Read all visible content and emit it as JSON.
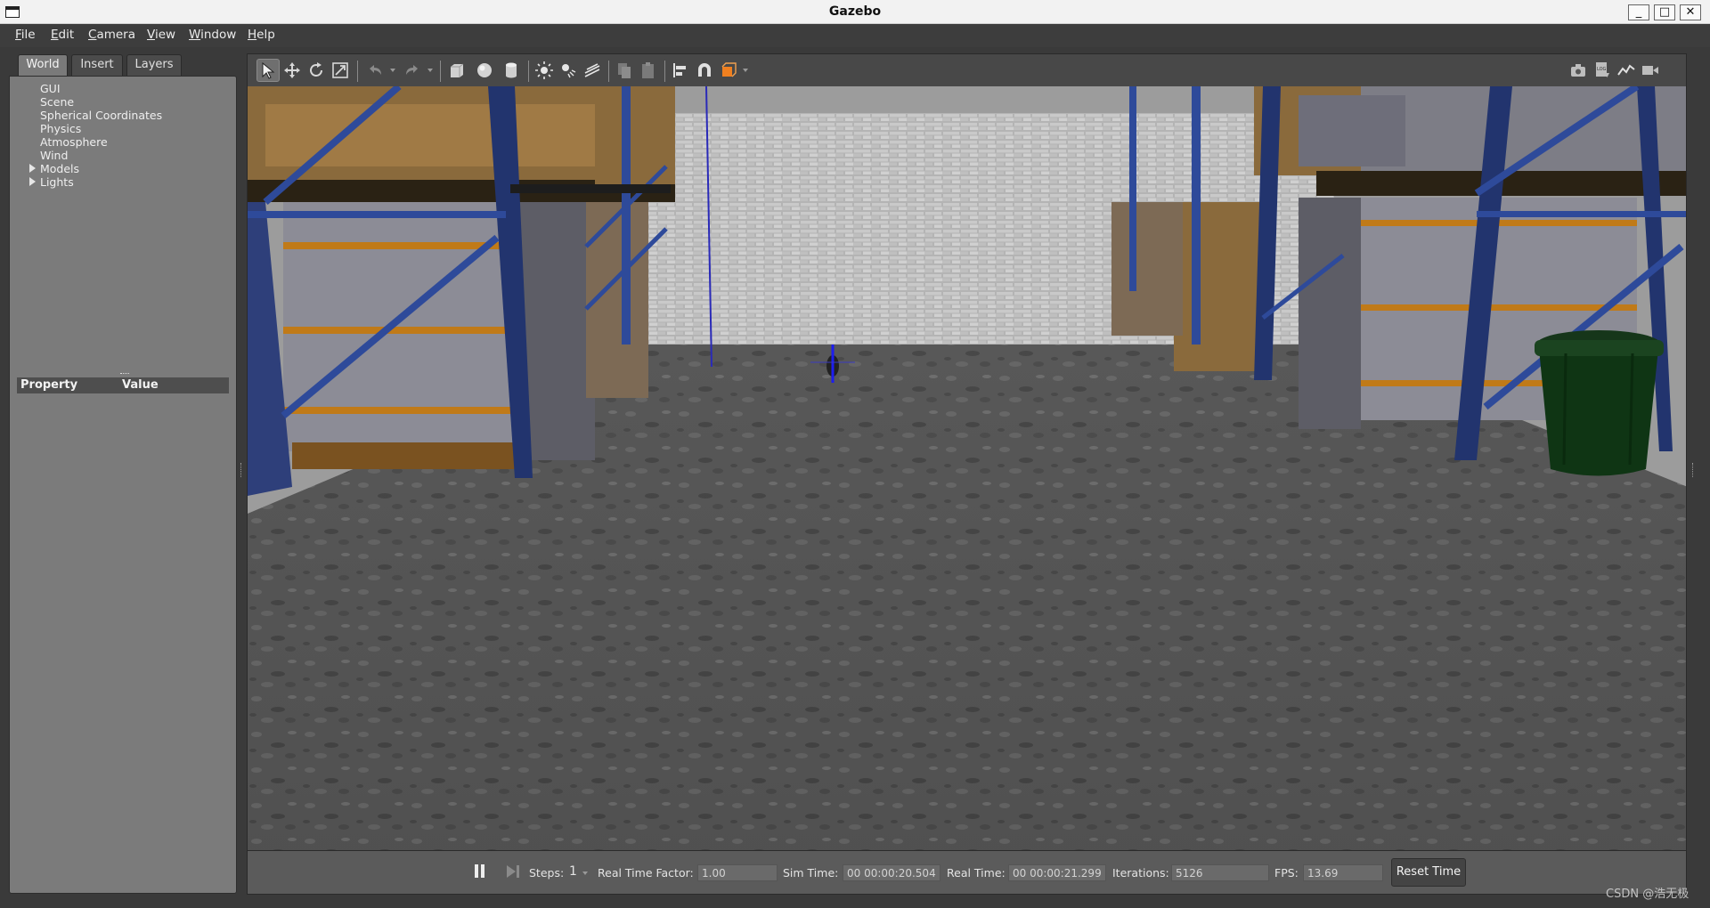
{
  "window": {
    "title": "Gazebo",
    "minimize": "_",
    "maximize": "□",
    "close": "✕"
  },
  "menu": [
    {
      "key": "F",
      "rest": "ile"
    },
    {
      "key": "E",
      "rest": "dit"
    },
    {
      "key": "C",
      "rest": "amera"
    },
    {
      "key": "V",
      "rest": "iew"
    },
    {
      "key": "W",
      "rest": "indow"
    },
    {
      "key": "H",
      "rest": "elp"
    }
  ],
  "left_panel": {
    "tabs": [
      "World",
      "Insert",
      "Layers"
    ],
    "active_tab": "World",
    "tree": [
      "GUI",
      "Scene",
      "Spherical Coordinates",
      "Physics",
      "Atmosphere",
      "Wind",
      "Models",
      "Lights"
    ],
    "property_header": "Property",
    "value_header": "Value"
  },
  "toolbar": {
    "tools": [
      "select-arrow-icon",
      "translate-icon",
      "rotate-icon",
      "scale-icon",
      "undo-icon",
      "redo-icon",
      "box-icon",
      "sphere-icon",
      "cylinder-icon",
      "point-light-icon",
      "spot-light-icon",
      "directional-light-icon",
      "copy-icon",
      "paste-icon",
      "align-icon",
      "magnet-snap-icon",
      "view-angle-icon"
    ],
    "right_tools": [
      "screenshot-icon",
      "log-icon",
      "plot-icon",
      "record-video-icon"
    ]
  },
  "bottom_bar": {
    "steps_label": "Steps:",
    "steps_value": "1",
    "rtf_label": "Real Time Factor:",
    "rtf_value": "1.00",
    "sim_time_label": "Sim Time:",
    "sim_time_value": "00 00:00:20.504",
    "real_time_label": "Real Time:",
    "real_time_value": "00 00:00:21.299",
    "iterations_label": "Iterations:",
    "iterations_value": "5126",
    "fps_label": "FPS:",
    "fps_value": "13.69",
    "reset_button": "Reset Time"
  },
  "watermark": "CSDN @浩无极"
}
